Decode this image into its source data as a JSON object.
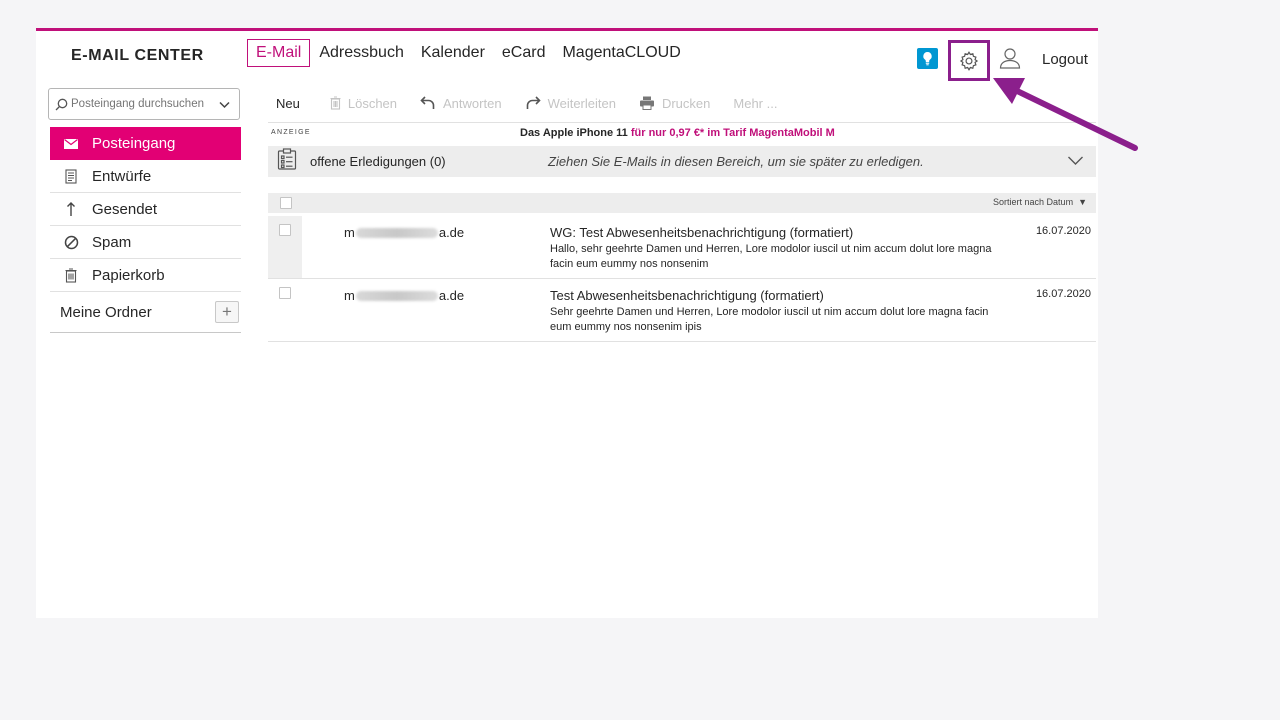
{
  "brand": "E-MAIL CENTER",
  "nav": {
    "email": "E-Mail",
    "adressbuch": "Adressbuch",
    "kalender": "Kalender",
    "ecard": "eCard",
    "magentacloud": "MagentaCLOUD",
    "logout": "Logout"
  },
  "search": {
    "placeholder": "Posteingang durchsuchen"
  },
  "folders": {
    "posteingang": "Posteingang",
    "entwuerfe": "Entwürfe",
    "gesendet": "Gesendet",
    "spam": "Spam",
    "papierkorb": "Papierkorb",
    "meine_ordner": "Meine Ordner"
  },
  "toolbar": {
    "neu": "Neu",
    "loeschen": "Löschen",
    "antworten": "Antworten",
    "weiterleiten": "Weiterleiten",
    "drucken": "Drucken",
    "mehr": "Mehr ..."
  },
  "ad": {
    "label": "ANZEIGE",
    "text_main": "Das Apple iPhone 11",
    "text_highlight": "für nur 0,97 €* im Tarif MagentaMobil M"
  },
  "todo": {
    "label": "offene Erledigungen (0)",
    "hint": "Ziehen Sie E-Mails in diesen Bereich, um sie später zu erledigen."
  },
  "list": {
    "sort_label": "Sortiert nach Datum"
  },
  "mails": [
    {
      "sender_start": "m",
      "sender_end": "a.de",
      "subject": "WG: Test Abwesenheitsbenachrichtigung (formatiert)",
      "preview": "Hallo, sehr geehrte Damen und Herren, Lore modolor iuscil ut nim accum dolut lore magna facin eum eummy nos nonsenim",
      "date": "16.07.2020"
    },
    {
      "sender_start": "m",
      "sender_end": "a.de",
      "subject": "Test Abwesenheitsbenachrichtigung (formatiert)",
      "preview": "Sehr geehrte Damen und Herren, Lore modolor iuscil ut nim accum dolut lore magna facin eum eummy nos nonsenim ipis",
      "date": "16.07.2020"
    }
  ],
  "colors": {
    "magenta": "#e20074",
    "frame_line": "#c0107a",
    "highlight_box": "#8b1f8c",
    "tip_blue": "#0097d2"
  }
}
